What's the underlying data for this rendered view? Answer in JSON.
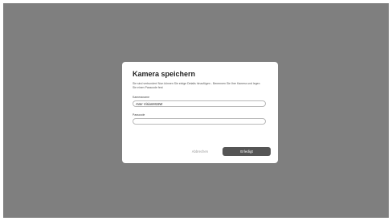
{
  "dialog": {
    "title": "Kamera speichern",
    "description": "Sie sind verbunden! Nun können Sie einige Details hinzufügen - Benennen Sie Ihre Kamera und legen Sie einen Passcode fest",
    "camera_name_label": "Kameraname",
    "camera_name_value": "AVer VisionM15W",
    "passcode_label": "Passcode",
    "passcode_value": "",
    "cancel_label": "Abbrechen",
    "done_label": "Erledigt"
  }
}
